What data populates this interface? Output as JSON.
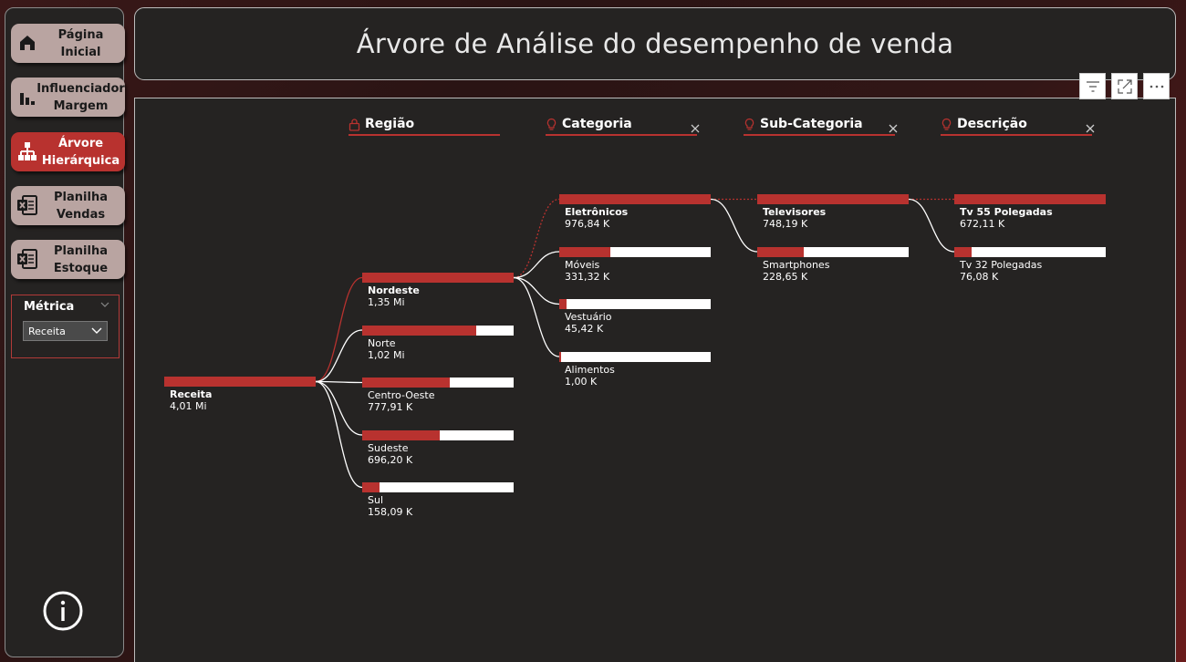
{
  "nav": [
    {
      "label": "Página\nInicial",
      "icon": "home-icon",
      "active": false
    },
    {
      "label": "Influenciador\nMargem",
      "icon": "bar-chart-icon",
      "active": false
    },
    {
      "label": "Árvore\nHierárquica",
      "icon": "hierarchy-icon",
      "active": true
    },
    {
      "label": "Planilha\nVendas",
      "icon": "spreadsheet-icon",
      "active": false
    },
    {
      "label": "Planilha\nEstoque",
      "icon": "spreadsheet-icon",
      "active": false
    }
  ],
  "metric": {
    "title": "Métrica",
    "selected": "Receita"
  },
  "title": "Árvore de Análise do desempenho de venda",
  "toolbar": [
    "filter-icon",
    "focus-mode-icon",
    "more-options-icon"
  ],
  "chart_data": {
    "type": "decomposition-tree",
    "levels": [
      {
        "label": "Região",
        "icon": "lock-icon",
        "removable": false
      },
      {
        "label": "Categoria",
        "icon": "lightbulb-icon",
        "removable": true
      },
      {
        "label": "Sub-Categoria",
        "icon": "lightbulb-icon",
        "removable": true
      },
      {
        "label": "Descrição",
        "icon": "lightbulb-icon",
        "removable": true
      }
    ],
    "root": {
      "name": "Receita",
      "label": "4,01 Mi",
      "value": 4.01
    },
    "columns": [
      {
        "parent": 0,
        "nodes": [
          {
            "name": "Nordeste",
            "label": "1,35 Mi",
            "fraction": 1.0,
            "selected": true
          },
          {
            "name": "Norte",
            "label": "1,02 Mi",
            "fraction": 0.755
          },
          {
            "name": "Centro-Oeste",
            "label": "777,91 K",
            "fraction": 0.576
          },
          {
            "name": "Sudeste",
            "label": "696,20 K",
            "fraction": 0.515
          },
          {
            "name": "Sul",
            "label": "158,09 K",
            "fraction": 0.117
          }
        ]
      },
      {
        "parent": 0,
        "nodes": [
          {
            "name": "Eletrônicos",
            "label": "976,84 K",
            "fraction": 1.0,
            "selected": true
          },
          {
            "name": "Móveis",
            "label": "331,32 K",
            "fraction": 0.339
          },
          {
            "name": "Vestuário",
            "label": "45,42 K",
            "fraction": 0.046
          },
          {
            "name": "Alimentos",
            "label": "1,00 K",
            "fraction": 0.001
          }
        ]
      },
      {
        "parent": 0,
        "nodes": [
          {
            "name": "Televisores",
            "label": "748,19 K",
            "fraction": 1.0,
            "selected": true
          },
          {
            "name": "Smartphones",
            "label": "228,65 K",
            "fraction": 0.306
          }
        ]
      },
      {
        "parent": 0,
        "nodes": [
          {
            "name": "Tv 55 Polegadas",
            "label": "672,11 K",
            "fraction": 1.0,
            "selected": true
          },
          {
            "name": "Tv 32 Polegadas",
            "label": "76,08 K",
            "fraction": 0.113
          }
        ]
      }
    ],
    "colors": {
      "accent": "#b8322f",
      "bar_bg": "#ffffff",
      "link": "#ffffff"
    }
  }
}
